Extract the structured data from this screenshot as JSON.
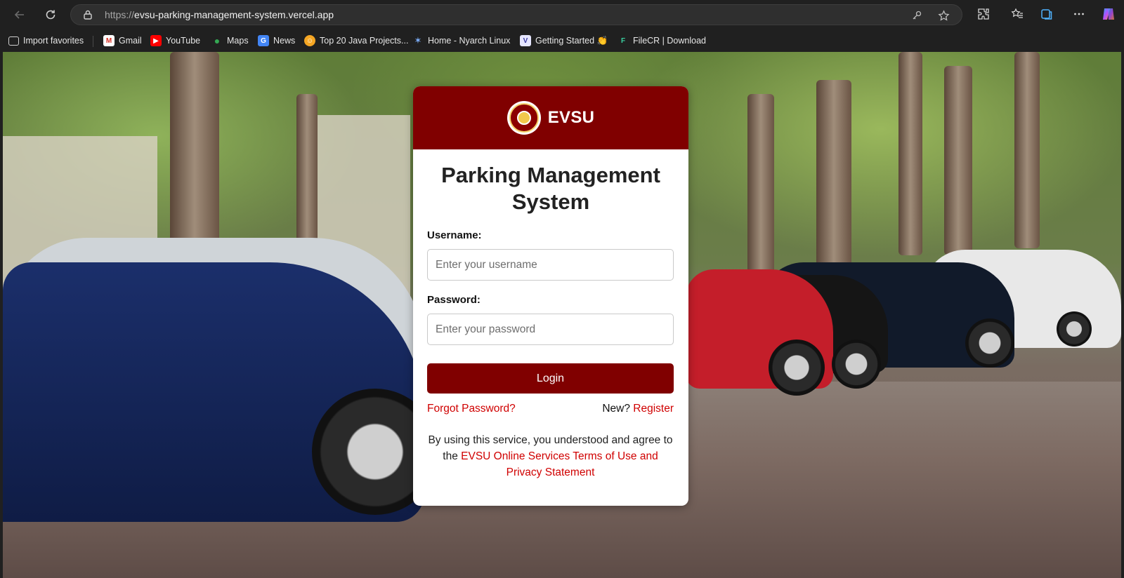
{
  "browser": {
    "url_scheme": "https://",
    "url_host": "evsu-parking-management-system.vercel.app",
    "bookmarks": [
      {
        "label": "Import favorites"
      },
      {
        "label": "Gmail"
      },
      {
        "label": "YouTube"
      },
      {
        "label": "Maps"
      },
      {
        "label": "News"
      },
      {
        "label": "Top 20 Java Projects..."
      },
      {
        "label": "Home - Nyarch Linux"
      },
      {
        "label": "Getting Started 👏"
      },
      {
        "label": "FileCR | Download"
      }
    ]
  },
  "login": {
    "brand": "EVSU",
    "title": "Parking Management System",
    "username_label": "Username:",
    "username_placeholder": "Enter your username",
    "password_label": "Password:",
    "password_placeholder": "Enter your password",
    "login_button": "Login",
    "forgot_link": "Forgot Password?",
    "new_text": "New?",
    "register_link": "Register",
    "terms_text": "By using this service, you understood and agree to the",
    "terms_link": "EVSU Online Services Terms of Use and Privacy Statement"
  },
  "colors": {
    "brand_maroon": "#800000",
    "link_red": "#d00000"
  }
}
